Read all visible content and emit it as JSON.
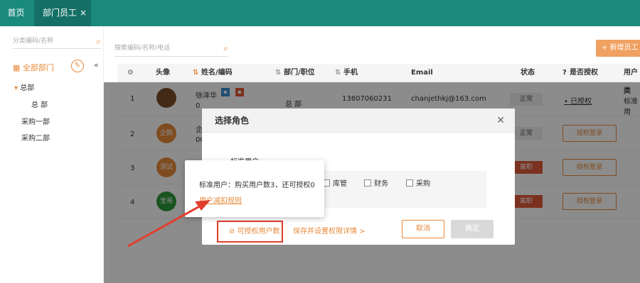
{
  "tabs": {
    "home": "首页",
    "active": "部门员工",
    "close": "×"
  },
  "left_panel": {
    "search_placeholder": "分类编码/名称",
    "all_dept": "全部部门",
    "tree": [
      "总部",
      "总 部",
      "采购一部",
      "采购二部"
    ]
  },
  "toolbar": {
    "search_placeholder": "搜索编码/名称/电话",
    "add_button": "+ 新增员工"
  },
  "table": {
    "headers": [
      "头像",
      "姓名/编码",
      "部门/职位",
      "手机",
      "Email",
      "状态",
      "是否授权",
      "用户类"
    ],
    "rows": [
      {
        "index": "1",
        "name": "徐泽华",
        "code": "0",
        "dept": "总 部",
        "phone": "13807060231",
        "email": "chanjethkj@163.com",
        "status": "正常",
        "auth": "已授权",
        "user_type": "标准用"
      },
      {
        "index": "2",
        "name": "企",
        "code": "00",
        "avatar_text": "企鹅",
        "status": "正常",
        "auth_btn": "授权登录"
      },
      {
        "index": "3",
        "avatar_text": "测试",
        "status": "离职",
        "auth_btn": "授权登录"
      },
      {
        "index": "4",
        "avatar_text": "宝哥",
        "status": "离职",
        "auth_btn": "授权登录"
      }
    ]
  },
  "dialog": {
    "title": "选择角色",
    "role_label": "标准用户",
    "checkboxes": [
      "库管",
      "财务",
      "采购"
    ],
    "grant_link": "可授权用户数",
    "save_link": "保存并设置权限详情 >",
    "cancel": "取消",
    "confirm": "确定"
  },
  "tooltip": {
    "text": "标准用户：购买用户数3，还可授权0",
    "link": "用户减扣规则"
  },
  "colors": {
    "teal": "#1b8a7e",
    "orange": "#e88a3b",
    "red": "#e23d2d"
  }
}
